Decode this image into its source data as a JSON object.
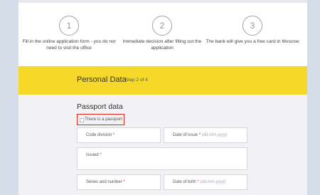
{
  "steps": [
    {
      "number": "1",
      "text": "Fill in the online application form - you do not need to visit the office"
    },
    {
      "number": "2",
      "text": "Immediate decision after filling out the application"
    },
    {
      "number": "3",
      "text": "The bank will give you a free card in Moscow"
    }
  ],
  "band": {
    "title": "Personal Data",
    "step": "Step 2 of 4"
  },
  "passport": {
    "title": "Passport data",
    "checkbox_label": "There is a passport",
    "fields": {
      "code_division": {
        "label": "Code division",
        "req": "*"
      },
      "date_of_issue": {
        "label": "Date of issue",
        "req": "*",
        "hint": "dd.mm.yyyy"
      },
      "issued": {
        "label": "Issued",
        "req": "*"
      },
      "series_number": {
        "label": "Series and number",
        "req": "*"
      },
      "date_of_birth": {
        "label": "Date of birth",
        "req": "*",
        "hint": "dd.mm.yyyy"
      }
    }
  },
  "colors": {
    "accent_band": "#f6d82a",
    "highlight": "#e0261c",
    "background": "#d4dde8"
  }
}
